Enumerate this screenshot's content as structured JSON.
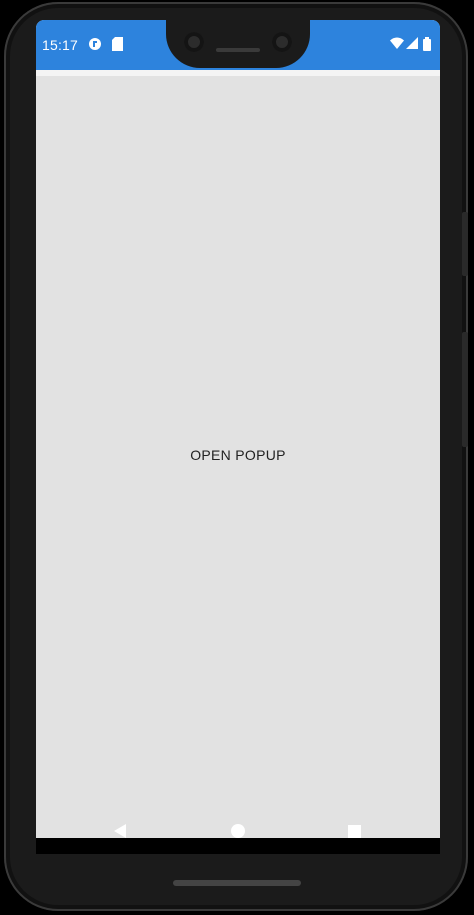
{
  "status_bar": {
    "time": "15:17",
    "left_icons": [
      "settings-badge-icon",
      "sim-card-icon"
    ],
    "right_icons": [
      "wifi-icon",
      "signal-icon",
      "battery-icon"
    ],
    "color": "#2d83dd"
  },
  "content": {
    "open_popup_label": "OPEN POPUP"
  },
  "navigation": {
    "buttons": [
      "back-icon",
      "home-icon",
      "recents-icon"
    ]
  },
  "colors": {
    "background": "#e2e2e2",
    "accent": "#2d83dd"
  }
}
